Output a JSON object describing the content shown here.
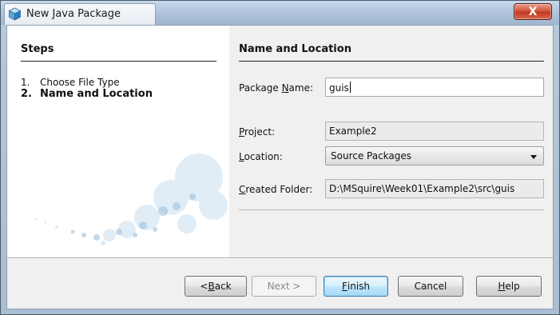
{
  "window": {
    "title": "New Java Package",
    "close_label": "X"
  },
  "steps": {
    "title": "Steps",
    "items": [
      {
        "number": "1.",
        "label": "Choose File Type"
      },
      {
        "number": "2.",
        "label": "Name and Location"
      }
    ],
    "current_index": 1
  },
  "main": {
    "section_title": "Name and Location",
    "package_name_label_pre": "Package ",
    "package_name_label_key": "N",
    "package_name_label_post": "ame:",
    "package_name_value": "guis",
    "project_label_key": "P",
    "project_label_post": "roject:",
    "project_value": "Example2",
    "location_label_key": "L",
    "location_label_post": "ocation:",
    "location_value": "Source Packages",
    "created_folder_label_key": "C",
    "created_folder_label_post": "reated Folder:",
    "created_folder_value": "D:\\MSquire\\Week01\\Example2\\src\\guis"
  },
  "buttons": {
    "back_pre": "< ",
    "back_key": "B",
    "back_post": "ack",
    "next": "Next >",
    "finish_key": "F",
    "finish_post": "inish",
    "cancel": "Cancel",
    "help_key": "H",
    "help_post": "elp"
  },
  "colors": {
    "title_bar": "#b1c6dd",
    "close_button": "#c13a22",
    "panel_bg": "#f0f0f0",
    "default_button_border": "#3c7fb1"
  }
}
